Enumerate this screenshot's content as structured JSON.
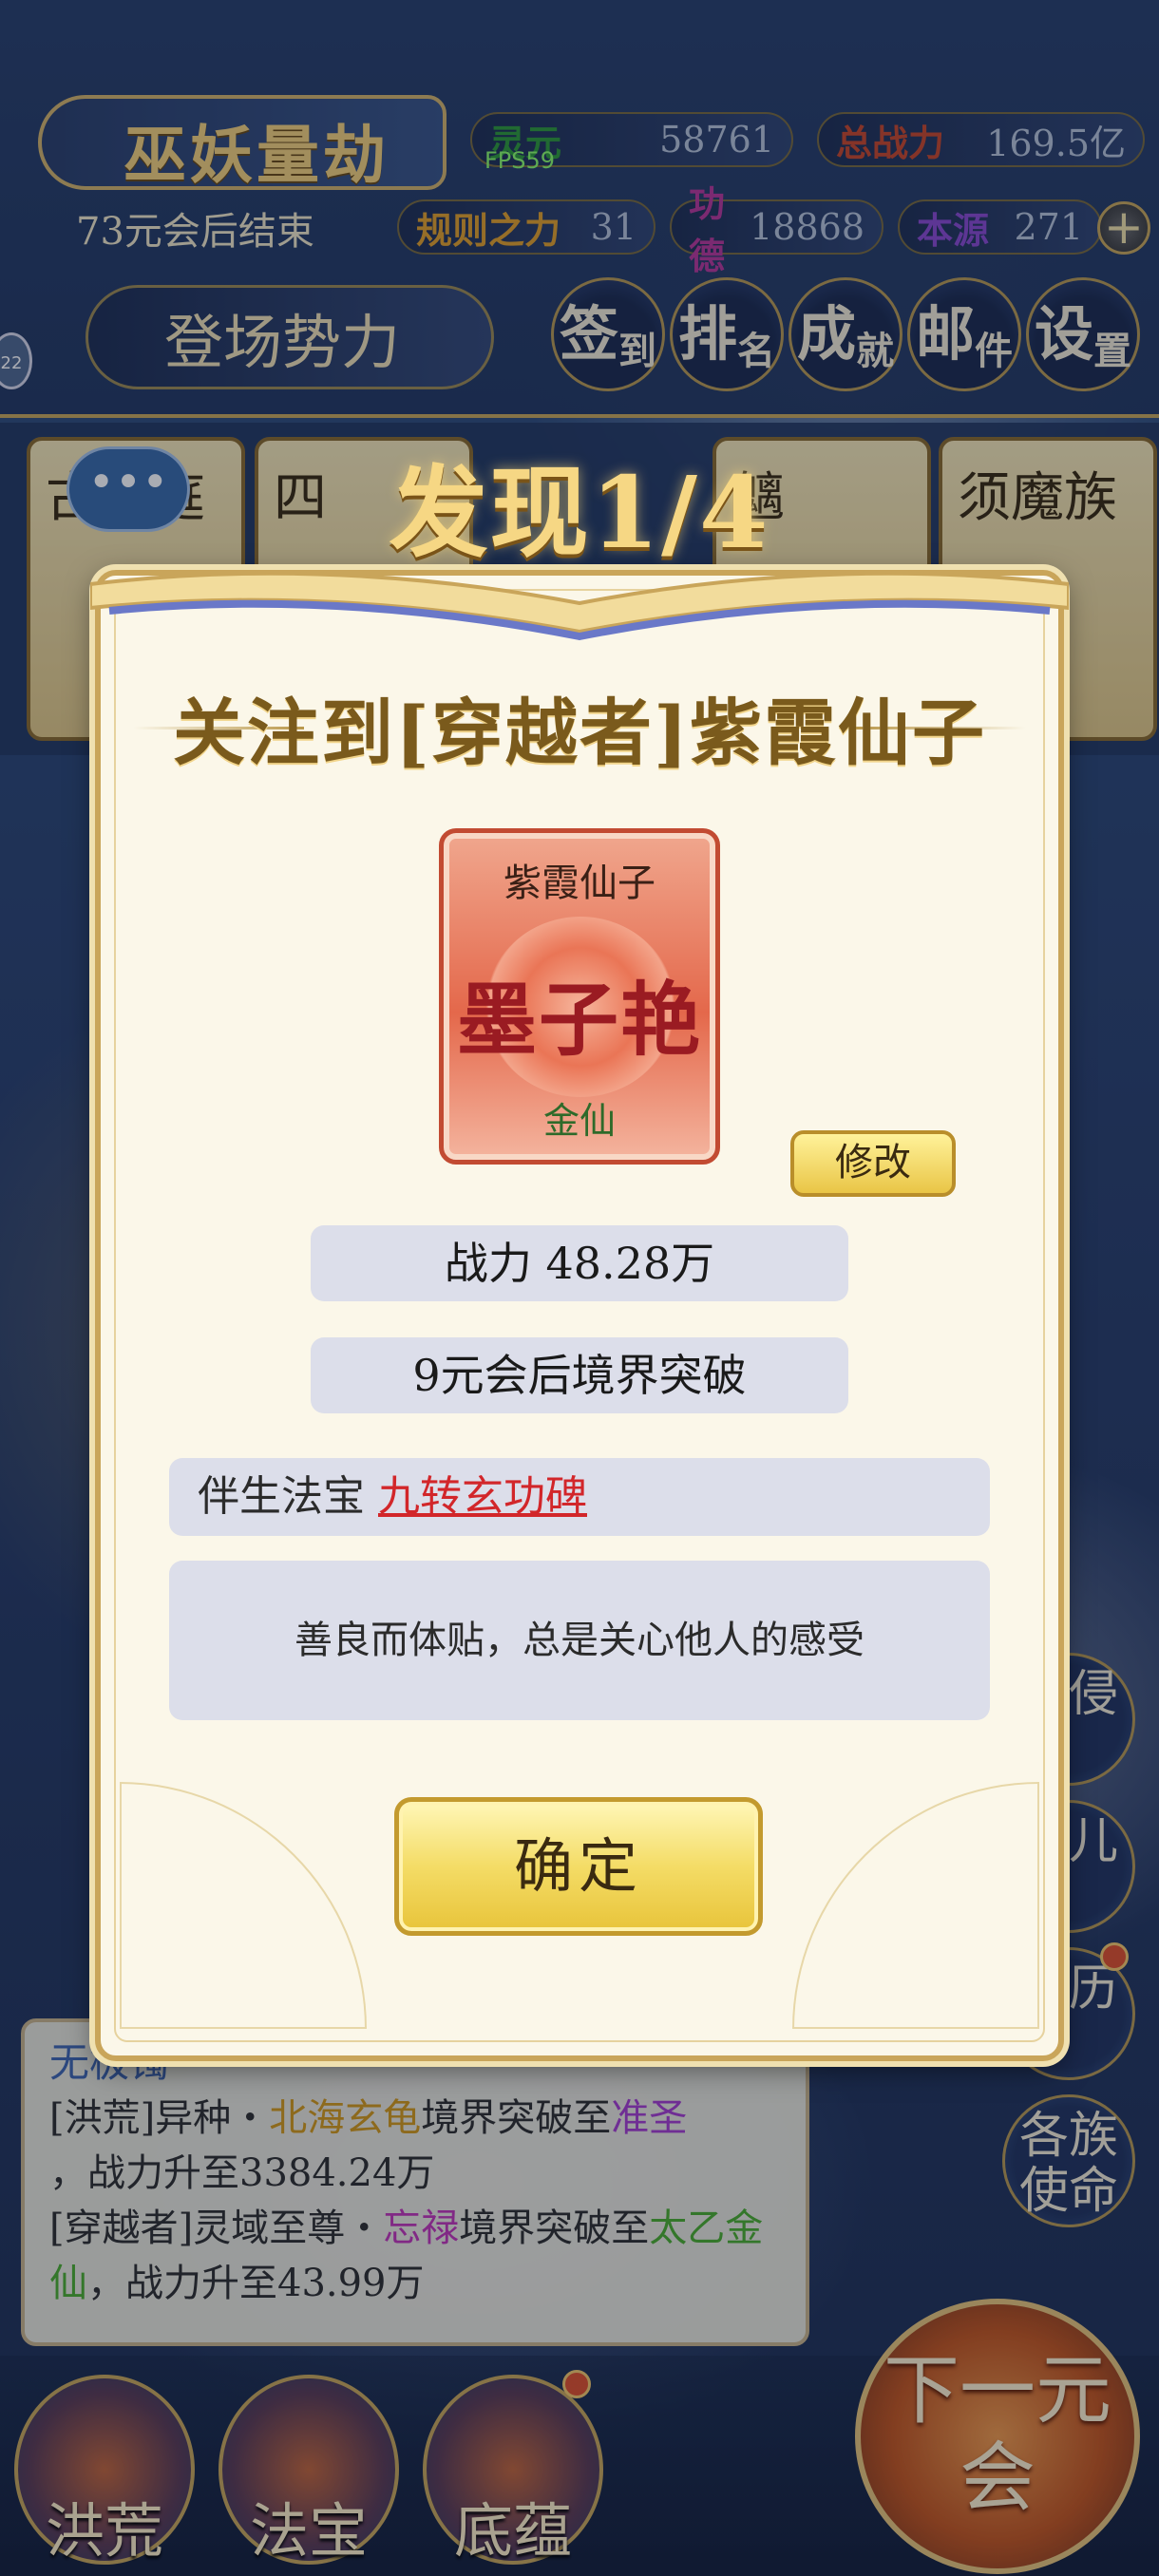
{
  "header": {
    "game_title": "巫妖量劫",
    "countdown": "73元会后结束",
    "fps": "FPS59",
    "lingyuan_label": "灵元",
    "lingyuan_value": "58761",
    "total_power_label": "总战力",
    "total_power_value": "169.5亿",
    "rule_label": "规则之力",
    "rule_value": "31",
    "merit_label": "功德",
    "merit_value": "18868",
    "origin_label": "本源",
    "origin_value": "271",
    "faction_button": "登场势力",
    "side_badge": "22"
  },
  "menu": [
    {
      "main": "签",
      "sub": "到"
    },
    {
      "main": "排",
      "sub": "名"
    },
    {
      "main": "成",
      "sub": "就"
    },
    {
      "main": "邮",
      "sub": "件"
    },
    {
      "main": "设",
      "sub": "置"
    }
  ],
  "tiles": [
    "古天庭",
    "四",
    "魑",
    "须魔族"
  ],
  "dialog": {
    "discover_title": "发现1/4",
    "header": "关注到[穿越者]紫霞仙子",
    "card_name": "紫霞仙子",
    "card_big_name": "墨子艳",
    "card_rank": "金仙",
    "edit_button": "修改",
    "power": "战力 48.28万",
    "breakthrough": "9元会后境界突破",
    "treasure_label": "伴生法宝",
    "treasure_name": "九转玄功碑",
    "description": "善良而体贴，总是关心他人的感受",
    "confirm_button": "确定"
  },
  "log": {
    "title": "无极镯",
    "line1_prefix": "[洪荒]异种・",
    "line1_name": "北海玄龟",
    "line1_mid": "境界突破至",
    "line1_rank": "准圣",
    "line1_suffix": "，战力升至3384.24万",
    "line2_prefix": "[穿越者]灵域至尊・",
    "line2_name": "忘禄",
    "line2_mid": "境界突破至",
    "line2_rank": "太乙金仙",
    "line2_suffix": "，战力升至43.99万"
  },
  "right_buttons": [
    "域侵",
    "道儿",
    "身历",
    "各族使命"
  ],
  "bottom_nav": [
    "洪荒",
    "法宝",
    "底蕴"
  ],
  "next_button": "下一元会",
  "colors": {
    "gold": "#f6d784",
    "dialog_bg": "#fbf7e9",
    "confirm_yellow": "#f4dc66",
    "treasure_red": "#d2262a"
  }
}
